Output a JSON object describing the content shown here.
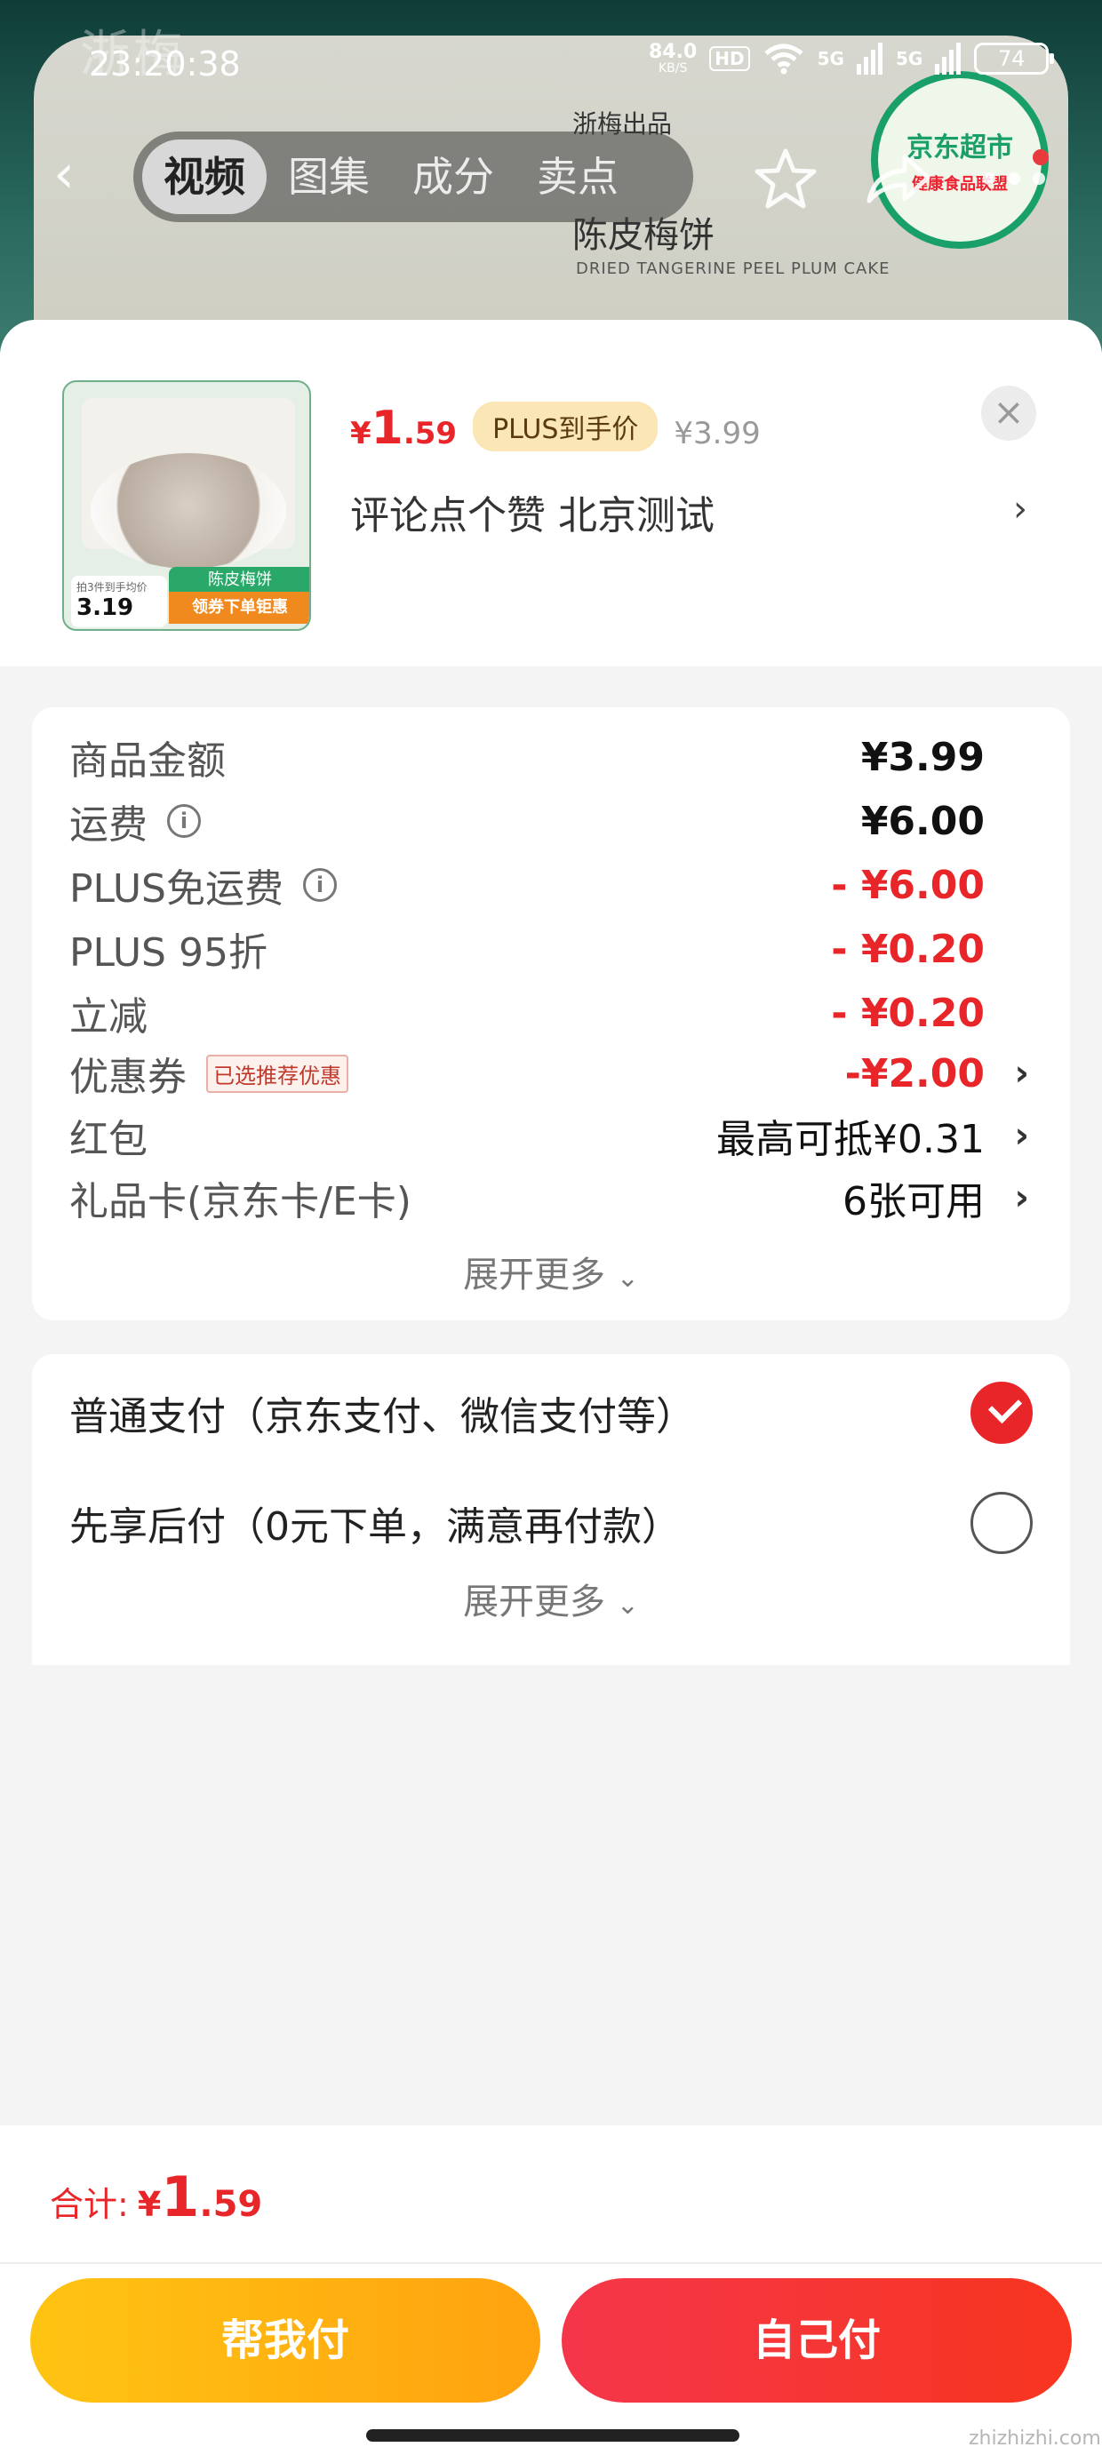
{
  "status_bar": {
    "time": "23:20:38",
    "net_speed": "84.0",
    "net_unit": "KB/S",
    "hd": "HD",
    "signal1": "5G",
    "signal2": "5G",
    "battery": "74"
  },
  "background": {
    "maker": "浙梅出品",
    "product_name": "陈皮梅饼",
    "product_name_en": "DRIED TANGERINE PEEL PLUM CAKE",
    "badge_title": "京东超市",
    "badge_sub": "健康食品联盟"
  },
  "nav": {
    "tabs": [
      "视频",
      "图集",
      "成分",
      "卖点"
    ],
    "active_tab": "视频"
  },
  "product": {
    "price_symbol": "¥",
    "price_main": "1",
    "price_decimal": ".59",
    "plus_tag": "PLUS到手价",
    "original_price": "¥3.99",
    "title": "评论点个赞  北京测试",
    "thumb": {
      "tag": "陈皮梅饼",
      "banner": "领券下单钜惠",
      "price_note": "拍3件到手均价",
      "price": "3.19"
    }
  },
  "price_breakdown": {
    "rows": [
      {
        "label": "商品金额",
        "value": "¥3.99"
      },
      {
        "label": "运费",
        "value": "¥6.00"
      },
      {
        "label": "PLUS免运费",
        "value": "- ¥6.00"
      },
      {
        "label": "PLUS 95折",
        "value": "- ¥0.20"
      },
      {
        "label": "立减",
        "value": "- ¥0.20"
      },
      {
        "label": "优惠券",
        "tag": "已选推荐优惠",
        "value": "-¥2.00"
      },
      {
        "label": "红包",
        "value": "最高可抵¥0.31"
      },
      {
        "label": "礼品卡(京东卡/E卡)",
        "value": "6张可用"
      }
    ],
    "expand_label": "展开更多"
  },
  "payment": {
    "options": [
      {
        "label": "普通支付（京东支付、微信支付等）",
        "checked": true
      },
      {
        "label": "先享后付（0元下单，满意再付款）",
        "checked": false
      }
    ],
    "expand_label": "展开更多"
  },
  "footer": {
    "total_label": "合计:",
    "total_symbol": "¥",
    "total_main": "1",
    "total_decimal": ".59",
    "help_pay": "帮我付",
    "self_pay": "自己付",
    "watermark": "zhizhizhi.com"
  },
  "colors": {
    "accent_red": "#e8262a",
    "help_button": "#ffb012",
    "self_button": "#f5364a"
  }
}
